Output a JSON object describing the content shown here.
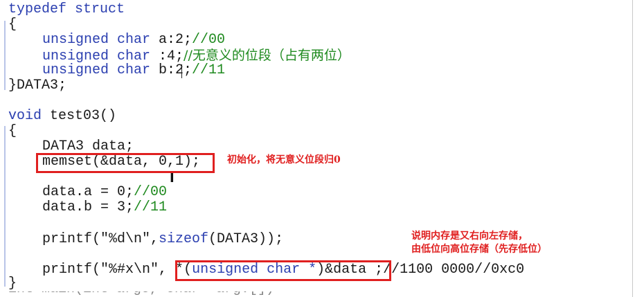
{
  "code": {
    "l1": {
      "kw": "typedef struct"
    },
    "l2": {
      "text": "{"
    },
    "l3": {
      "kw": "unsigned char",
      "rest": " a:2;",
      "comment": "//00"
    },
    "l4": {
      "kw": "unsigned char",
      "rest": " :4;",
      "comment": "//无意义的位段（占有两位）"
    },
    "l5": {
      "kw": "unsigned char",
      "rest": " b:2;",
      "comment": "//11"
    },
    "l6": {
      "text": "}DATA3;"
    },
    "l7": {
      "kw": "void",
      "rest": " test03()"
    },
    "l8": {
      "text": "{"
    },
    "l9": {
      "text": "DATA3 data;"
    },
    "l10": {
      "text": "memset(&data, 0,1);"
    },
    "l11": {
      "rest": "data.a = 0;",
      "comment": "//00"
    },
    "l12": {
      "rest": "data.b = 3;",
      "comment": "//11"
    },
    "l13": {
      "pre": "printf(\"%d\\n\",",
      "kw": "sizeof",
      "post": "(DATA3));"
    },
    "l14": {
      "pre": "printf(\"%#x\\n\",",
      "star": "*(",
      "kw": "unsigned char *",
      "post": ")&data",
      "tail": ";//1100 0000//0xc0"
    },
    "l15": {
      "text": "}"
    },
    "cutoff": {
      "text": "int main(int argc, char *argv[])"
    }
  },
  "annotations": {
    "memset_note": "初始化，将无意义位段归0",
    "order_note_line1": "说明内存是又右向左存储，",
    "order_note_line2": "由低位向高位存储（先存低位）"
  },
  "colors": {
    "keyword": "#2b3fb0",
    "comment": "#1f8a1f",
    "annotation": "#e02020",
    "text": "#1a1a1a"
  }
}
